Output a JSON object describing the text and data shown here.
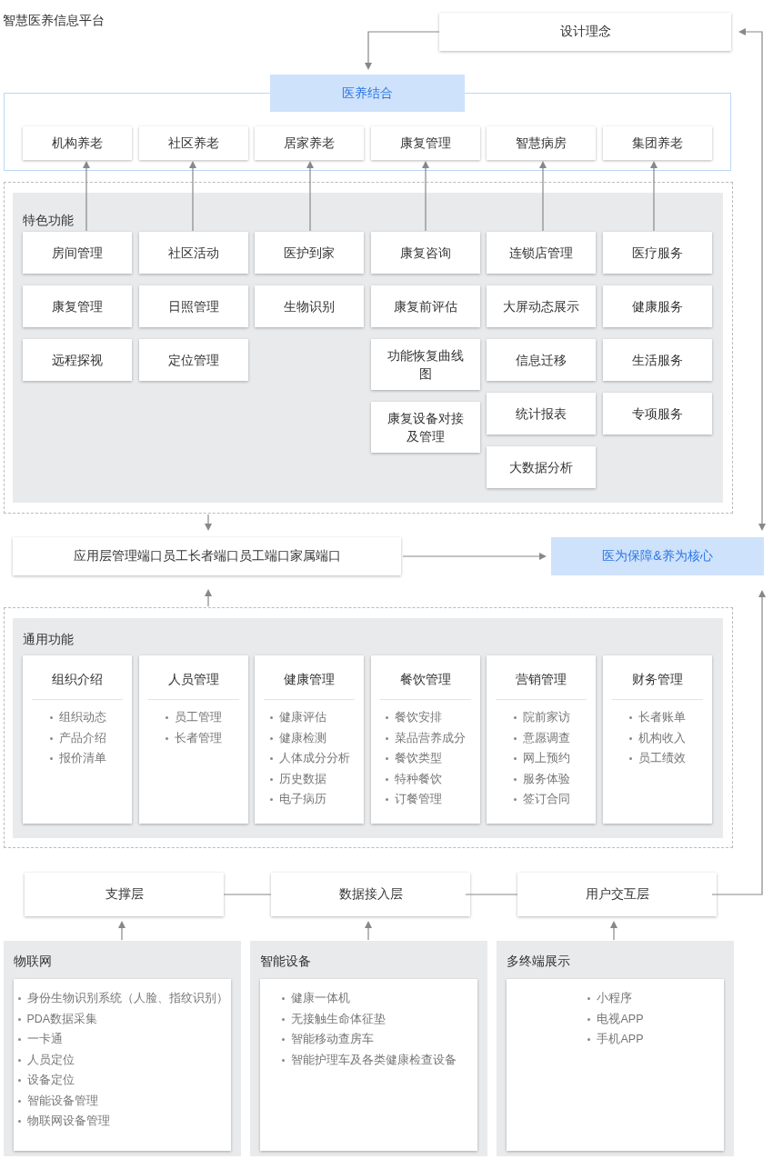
{
  "title": "智慧医养信息平台",
  "design_concept": "设计理念",
  "integration": {
    "title": "医养结合",
    "items": [
      "机构养老",
      "社区养老",
      "居家养老",
      "康复管理",
      "智慧病房",
      "集团养老"
    ]
  },
  "features": {
    "title": "特色功能",
    "columns": [
      [
        "房间管理",
        "康复管理",
        "远程探视"
      ],
      [
        "社区活动",
        "日照管理",
        "定位管理"
      ],
      [
        "医护到家",
        "生物识别"
      ],
      [
        "康复咨询",
        "康复前评估",
        "功能恢复曲线图",
        "康复设备对接及管理"
      ],
      [
        "连锁店管理",
        "大屏动态展示",
        "信息迁移",
        "统计报表",
        "大数据分析"
      ],
      [
        "医疗服务",
        "健康服务",
        "生活服务",
        "专项服务"
      ]
    ]
  },
  "application_layer": "应用层管理端口员工长者端口员工端口家属端口",
  "core": "医为保障&养为核心",
  "common": {
    "title": "通用功能",
    "modules": [
      {
        "title": "组织介绍",
        "items": [
          "组织动态",
          "产品介绍",
          "报价清单"
        ]
      },
      {
        "title": "人员管理",
        "items": [
          "员工管理",
          "长者管理"
        ]
      },
      {
        "title": "健康管理",
        "items": [
          "健康评估",
          "健康检测",
          "人体成分分析",
          "历史数据",
          "电子病历"
        ]
      },
      {
        "title": "餐饮管理",
        "items": [
          "餐饮安排",
          "菜品营养成分",
          "餐饮类型",
          "特种餐饮",
          "订餐管理"
        ]
      },
      {
        "title": "营销管理",
        "items": [
          "院前家访",
          "意愿调查",
          "网上预约",
          "服务体验",
          "签订合同"
        ]
      },
      {
        "title": "财务管理",
        "items": [
          "长者账单",
          "机构收入",
          "员工绩效"
        ]
      }
    ]
  },
  "layers": [
    "支撑层",
    "数据接入层",
    "用户交互层"
  ],
  "foundations": [
    {
      "title": "物联网",
      "items": [
        "身份生物识别系统（人脸、指纹识别）",
        "PDA数据采集",
        "一卡通",
        "人员定位",
        "设备定位",
        "智能设备管理",
        "物联网设备管理"
      ]
    },
    {
      "title": "智能设备",
      "items": [
        "健康一体机",
        "无接触生命体征垫",
        "智能移动查房车",
        "智能护理车及各类健康检查设备"
      ]
    },
    {
      "title": "多终端展示",
      "items": [
        "小程序",
        "电视APP",
        "手机APP"
      ]
    }
  ]
}
